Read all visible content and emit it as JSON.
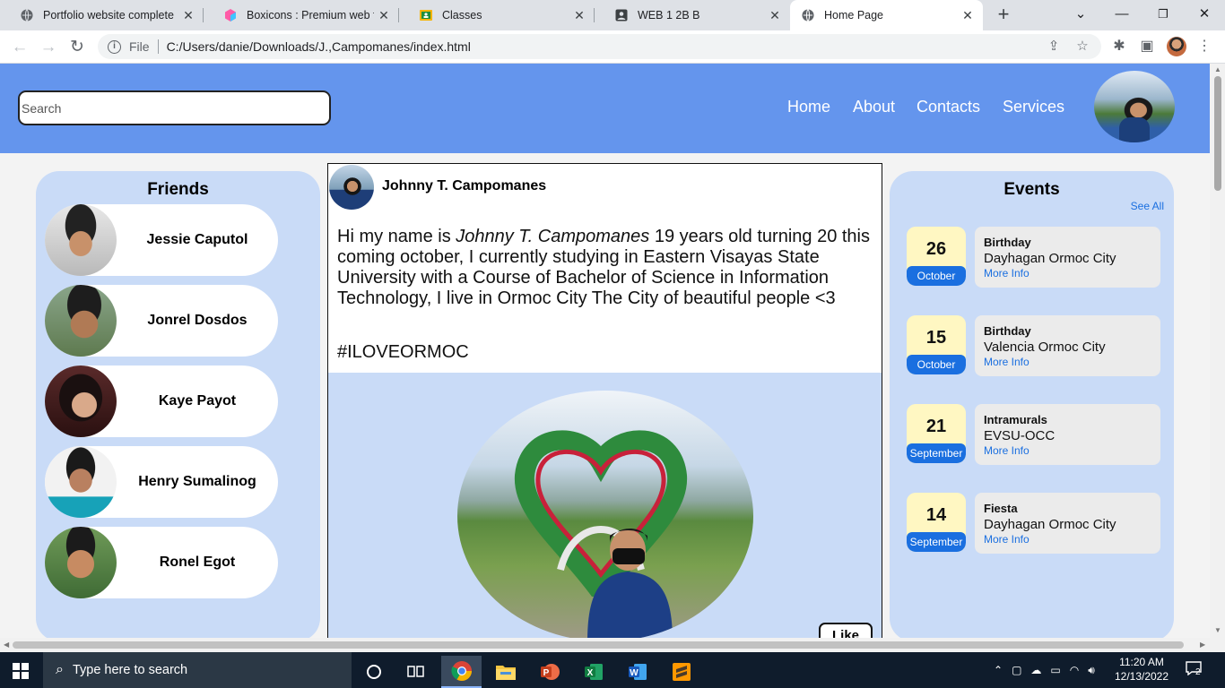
{
  "browser": {
    "tabs": [
      {
        "title": "Portfolio website complete",
        "icon": "globe-icon"
      },
      {
        "title": "Boxicons : Premium web frien",
        "icon": "boxicons-icon"
      },
      {
        "title": "Classes",
        "icon": "classroom-icon"
      },
      {
        "title": "WEB 1 2B B",
        "icon": "account-icon"
      },
      {
        "title": "Home Page",
        "icon": "globe-icon",
        "active": true
      }
    ],
    "new_tab_glyph": "+",
    "minimize_glyph": "—",
    "maximize_glyph": "❐",
    "close_glyph": "✕",
    "tabsearch_glyph": "⌄",
    "address": {
      "scheme_label": "File",
      "url": "C:/Users/danie/Downloads/J.,Campomanes/index.html"
    }
  },
  "header": {
    "search_placeholder": "Search",
    "nav": [
      "Home",
      "About",
      "Contacts",
      "Services"
    ]
  },
  "friends": {
    "title": "Friends",
    "items": [
      {
        "name": "Jessie Caputol"
      },
      {
        "name": "Jonrel Dosdos"
      },
      {
        "name": "Kaye Payot"
      },
      {
        "name": "Henry Sumalinog"
      },
      {
        "name": "Ronel Egot"
      }
    ]
  },
  "post": {
    "author": "Johnny T. Campomanes",
    "text_before": "Hi my name is ",
    "text_italic": "Johnny T. Campomanes",
    "text_after": " 19 years old turning 20 this coming october, I currently studying in Eastern Visayas State University with a Course of Bachelor of Science in Information Technology, I live in Ormoc City The City of beautiful people <3",
    "hashtag": "#ILOVEORMOC",
    "like_label": "Like"
  },
  "events": {
    "title": "Events",
    "see_all": "See All",
    "items": [
      {
        "day": "26",
        "month": "October",
        "title": "Birthday",
        "place": "Dayhagan Ormoc City",
        "more": "More Info"
      },
      {
        "day": "15",
        "month": "October",
        "title": "Birthday",
        "place": "Valencia Ormoc City",
        "more": "More Info"
      },
      {
        "day": "21",
        "month": "September",
        "title": "Intramurals",
        "place": "EVSU-OCC",
        "more": "More Info"
      },
      {
        "day": "14",
        "month": "September",
        "title": "Fiesta",
        "place": "Dayhagan Ormoc City",
        "more": "More Info"
      }
    ]
  },
  "taskbar": {
    "search_placeholder": "Type here to search",
    "time": "11:20 AM",
    "date": "12/13/2022",
    "notifications": "2"
  },
  "colors": {
    "header": "#6495ed",
    "panel": "#c9dbf7",
    "accent": "#1a6fe0",
    "date_bg": "#fff7c2"
  }
}
